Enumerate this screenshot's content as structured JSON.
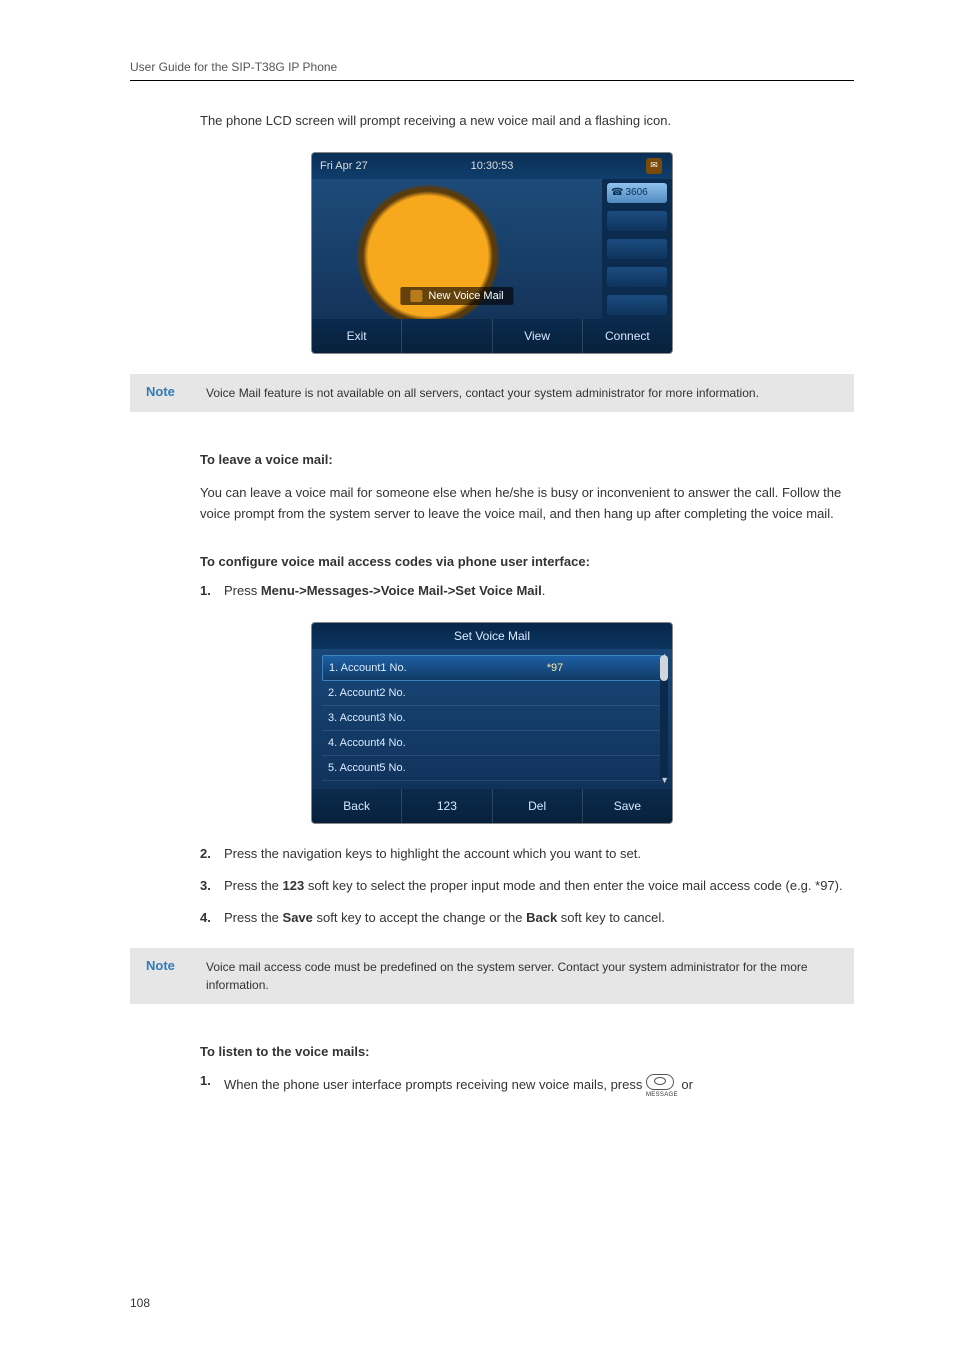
{
  "header": "User Guide for the SIP-T38G IP Phone",
  "intro_line": "The phone LCD screen will prompt receiving a new voice mail and a flashing icon.",
  "note1_label": "Note",
  "note1_text": "Voice Mail feature is not available on all servers, contact your system administrator for more information.",
  "h_leave": "To leave a voice mail:",
  "leave_para": "You can leave a voice mail for someone else when he/she is busy or inconvenient to answer the call. Follow the voice prompt from the system server to leave the voice mail, and then hang up after completing the voice mail.",
  "h_configure": "To configure voice mail access codes via phone user interface:",
  "step1_prefix": "Press ",
  "step1_bold": "Menu->Messages->Voice Mail->Set Voice Mail",
  "step1_suffix": ".",
  "step2": "Press the navigation keys to highlight the account which you want to set.",
  "step3_a": "Press the ",
  "step3_b": "123",
  "step3_c": " soft key to select the proper input mode and then enter the voice mail access code (e.g. *97).",
  "step4_a": "Press the ",
  "step4_b": "Save",
  "step4_c": " soft key to accept the change or the ",
  "step4_d": "Back",
  "step4_e": " soft key to cancel.",
  "note2_label": "Note",
  "note2_text": "Voice mail access code must be predefined on the system server. Contact your system administrator for the more information.",
  "h_listen": "To listen to the voice mails:",
  "listen1_a": "When the phone user interface prompts receiving new voice mails, press ",
  "listen1_b": " or",
  "msg_key_label": "MESSAGE",
  "shot1": {
    "date": "Fri Apr 27",
    "time": "10:30:53",
    "account": "3606",
    "banner": "New Voice Mail",
    "soft": [
      "Exit",
      "",
      "View",
      "Connect"
    ]
  },
  "shot2": {
    "title": "Set Voice Mail",
    "rows": [
      {
        "label": "1. Account1 No.",
        "val": "*97"
      },
      {
        "label": "2. Account2 No.",
        "val": ""
      },
      {
        "label": "3. Account3 No.",
        "val": ""
      },
      {
        "label": "4. Account4 No.",
        "val": ""
      },
      {
        "label": "5. Account5 No.",
        "val": ""
      }
    ],
    "soft": [
      "Back",
      "123",
      "Del",
      "Save"
    ]
  },
  "page_number": "108"
}
